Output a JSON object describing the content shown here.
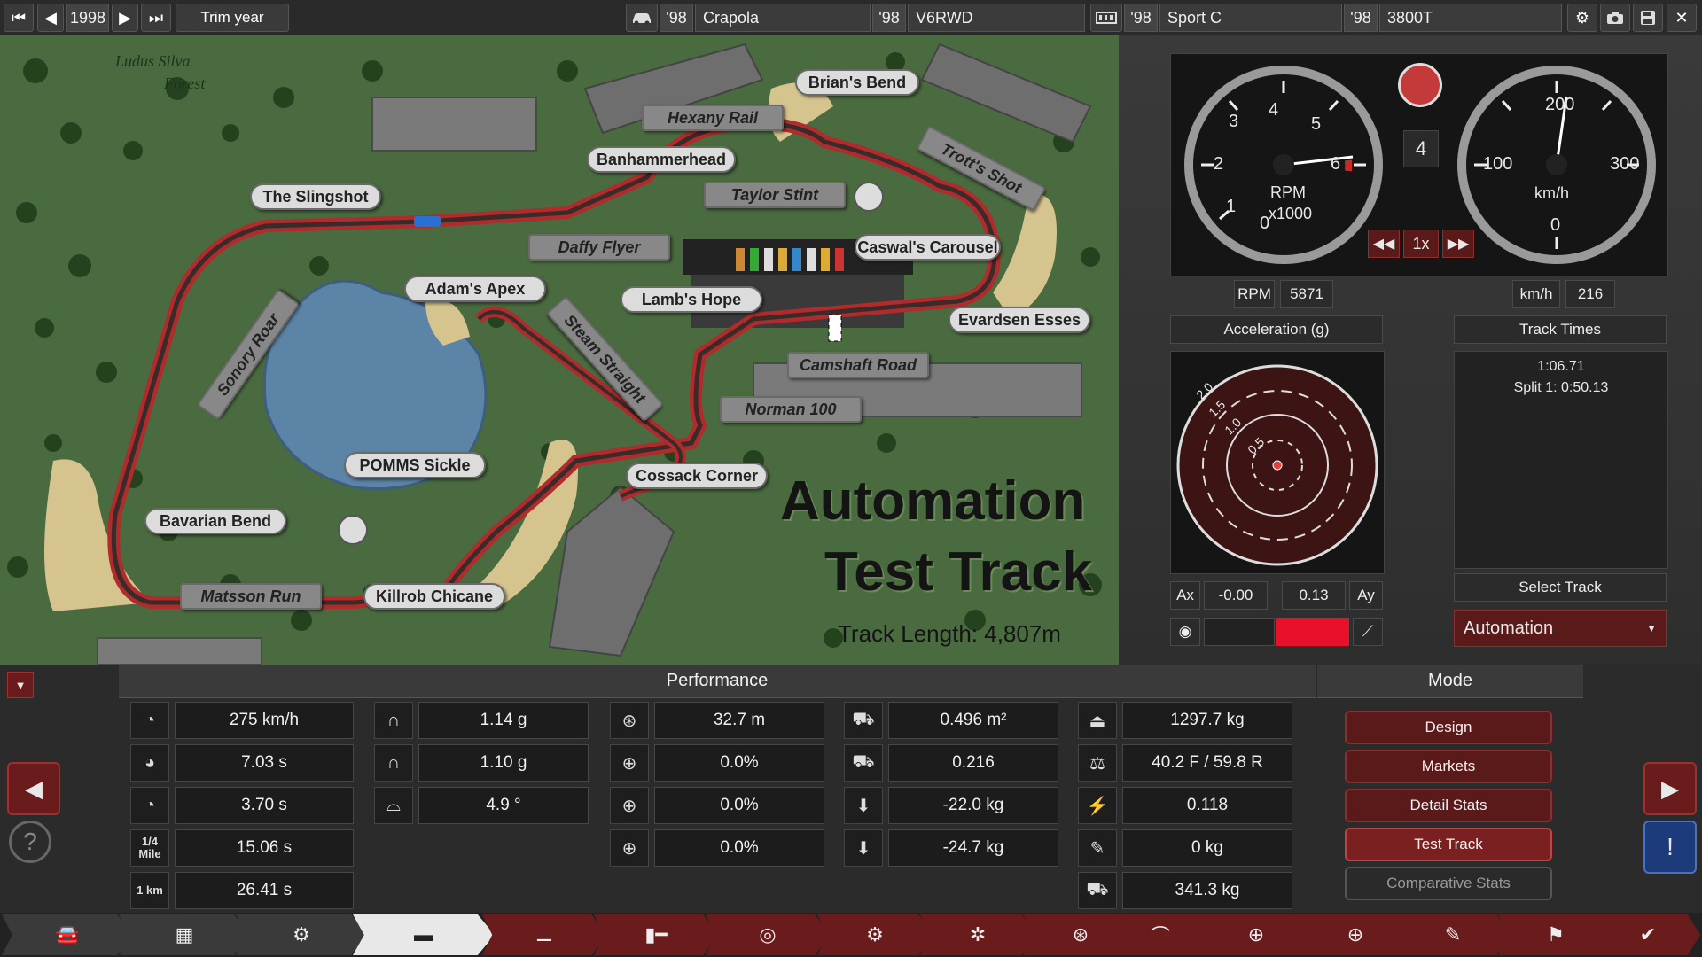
{
  "topbar": {
    "year": "1998",
    "trim_year_label": "Trim year",
    "model_year": "'98",
    "model_name": "Crapola",
    "engine_year": "'98",
    "engine_name": "V6RWD",
    "trim_year2": "'98",
    "trim_name": "Sport C",
    "variant_year": "'98",
    "variant_name": "3800T"
  },
  "map": {
    "title_line1": "Automation",
    "title_line2": "Test Track",
    "track_length": "Track Length: 4,807m",
    "forest_label_1": "Ludus Silva",
    "forest_label_2": "Forest",
    "labels": {
      "brians_bend": "Brian's Bend",
      "hexany_rail": "Hexany Rail",
      "trotts_shot": "Trott's Shot",
      "banhammerhead": "Banhammerhead",
      "the_slingshot": "The Slingshot",
      "taylor_stint": "Taylor Stint",
      "daffy_flyer": "Daffy Flyer",
      "caswals_carousel": "Caswal's Carousel",
      "adams_apex": "Adam's Apex",
      "lambs_hope": "Lamb's Hope",
      "evardsen_esses": "Evardsen Esses",
      "sonory_roar": "Sonory Roar",
      "steam_straight": "Steam Straight",
      "camshaft_road": "Camshaft Road",
      "norman_100": "Norman 100",
      "pomms_sickle": "POMMS Sickle",
      "cossack_corner": "Cossack Corner",
      "bavarian_bend": "Bavarian Bend",
      "matsson_run": "Matsson Run",
      "killrob_chicane": "Killrob Chicane"
    }
  },
  "gauges": {
    "rpm_label": "RPM",
    "rpm_unit": "x1000",
    "speed_unit": "km/h",
    "gear": "4",
    "playback_speed": "1x",
    "rpm_ticks": [
      "0",
      "1",
      "2",
      "3",
      "4",
      "5",
      "6"
    ],
    "speed_ticks": [
      "0",
      "100",
      "200",
      "300"
    ],
    "rpm_readout_label": "RPM",
    "rpm_readout_value": "5871",
    "speed_readout_label": "km/h",
    "speed_readout_value": "216"
  },
  "acceleration": {
    "title": "Acceleration (g)",
    "ring_labels": [
      "2.0",
      "1.5",
      "1.0",
      "0.5"
    ],
    "ax_label": "Ax",
    "ax_value": "-0.00",
    "ay_value": "0.13",
    "ay_label": "Ay"
  },
  "track_times": {
    "title": "Track Times",
    "lap": "1:06.71",
    "split": "Split 1: 0:50.13",
    "select_track_label": "Select Track",
    "selected_track": "Automation"
  },
  "performance": {
    "title": "Performance",
    "col1": [
      {
        "icon": "top-speed-icon",
        "value": "275 km/h"
      },
      {
        "icon": "acceleration-100-icon",
        "value": "7.03 s"
      },
      {
        "icon": "acceleration-80-icon",
        "value": "3.70 s"
      },
      {
        "icon": "quarter-mile-icon",
        "icon_text": "1/4 Mile",
        "value": "15.06 s"
      },
      {
        "icon": "one-km-icon",
        "icon_text": "1 km",
        "value": "26.41 s"
      }
    ],
    "col2": [
      {
        "icon": "lateral-g-icon",
        "value": "1.14 g"
      },
      {
        "icon": "lateral-g-slow-icon",
        "value": "1.10 g"
      },
      {
        "icon": "body-roll-icon",
        "value": "4.9 °"
      }
    ],
    "col3": [
      {
        "icon": "braking-distance-icon",
        "value": "32.7 m"
      },
      {
        "icon": "brake-fade-icon",
        "value": "0.0%"
      },
      {
        "icon": "brake-fade-race-icon",
        "value": "0.0%"
      },
      {
        "icon": "brake-fade-tow-icon",
        "value": "0.0%"
      }
    ],
    "col4": [
      {
        "icon": "frontal-area-icon",
        "value": "0.496 m²"
      },
      {
        "icon": "drag-coefficient-icon",
        "value": "0.216"
      },
      {
        "icon": "front-downforce-icon",
        "value": "-22.0 kg"
      },
      {
        "icon": "rear-downforce-icon",
        "value": "-24.7 kg"
      }
    ],
    "col5": [
      {
        "icon": "weight-icon",
        "value": "1297.7 kg"
      },
      {
        "icon": "weight-distribution-icon",
        "value": "40.2 F / 59.8 R"
      },
      {
        "icon": "power-to-weight-icon",
        "value": "0.118"
      },
      {
        "icon": "cargo-icon",
        "value": "0 kg"
      },
      {
        "icon": "towing-icon",
        "value": "341.3 kg"
      }
    ]
  },
  "mode": {
    "title": "Mode",
    "design": "Design",
    "markets": "Markets",
    "detail_stats": "Detail Stats",
    "test_track": "Test Track",
    "comparative_stats": "Comparative Stats"
  },
  "nav": {
    "tabs": [
      "car-icon",
      "chassis-icon",
      "suspension-icon",
      "body-icon",
      "fixtures-icon",
      "interior-icon",
      "headlights-icon",
      "gearbox-icon",
      "wheels-icon",
      "brakes-icon",
      "aero-icon",
      "steering-icon",
      "tune-icon",
      "tyres-icon",
      "test-track-icon",
      "done-icon"
    ]
  },
  "colors": {
    "accent_red": "#8a2424",
    "grass": "#4a6b3f",
    "track_red": "#8f2b2b"
  }
}
